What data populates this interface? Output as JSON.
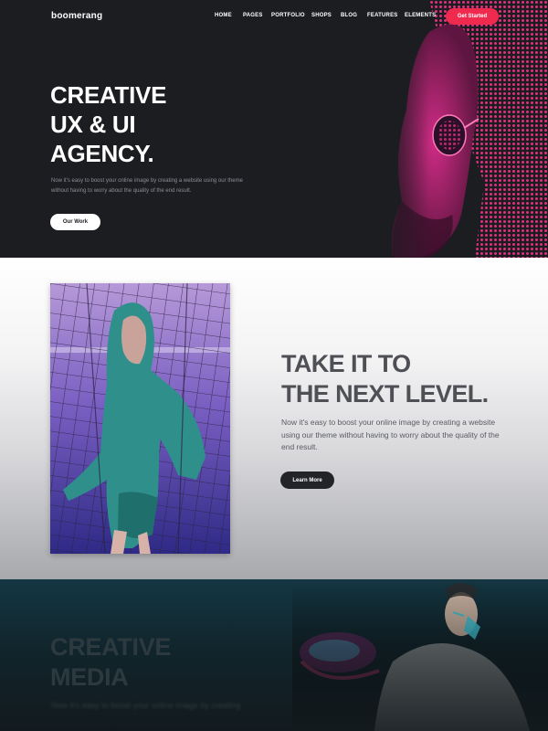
{
  "brand": {
    "logo_text_pre": "b",
    "logo_text_oo": "oo",
    "logo_text_post": "merang"
  },
  "nav": {
    "items": [
      "HOME",
      "PAGES",
      "PORTFOLIO",
      "SHOPS",
      "BLOG",
      "FEATURES",
      "ELEMENTS"
    ],
    "cta_label": "Get Started"
  },
  "hero": {
    "title_lines": [
      "CREATIVE",
      "UX & UI",
      "AGENCY."
    ],
    "description": "Now it's easy to boost your online image by creating a website using our theme without having to worry about the quality of the end result.",
    "button_label": "Our Work"
  },
  "section2": {
    "title_lines": [
      "TAKE IT TO",
      "THE NEXT LEVEL."
    ],
    "description": "Now it's easy to boost your online image by creating a website using our theme without having to worry about the quality of the end result.",
    "button_label": "Learn More"
  },
  "section3": {
    "title_lines": [
      "CREATIVE",
      "MEDIA"
    ],
    "description": "Now it's easy to boost your online image by creating"
  },
  "colors": {
    "hero_bg": "#1c1d21",
    "accent": "#f0294f",
    "hero_art_pink": "#e0307e",
    "section3_teal": "#143743",
    "dark_button": "#222428"
  }
}
